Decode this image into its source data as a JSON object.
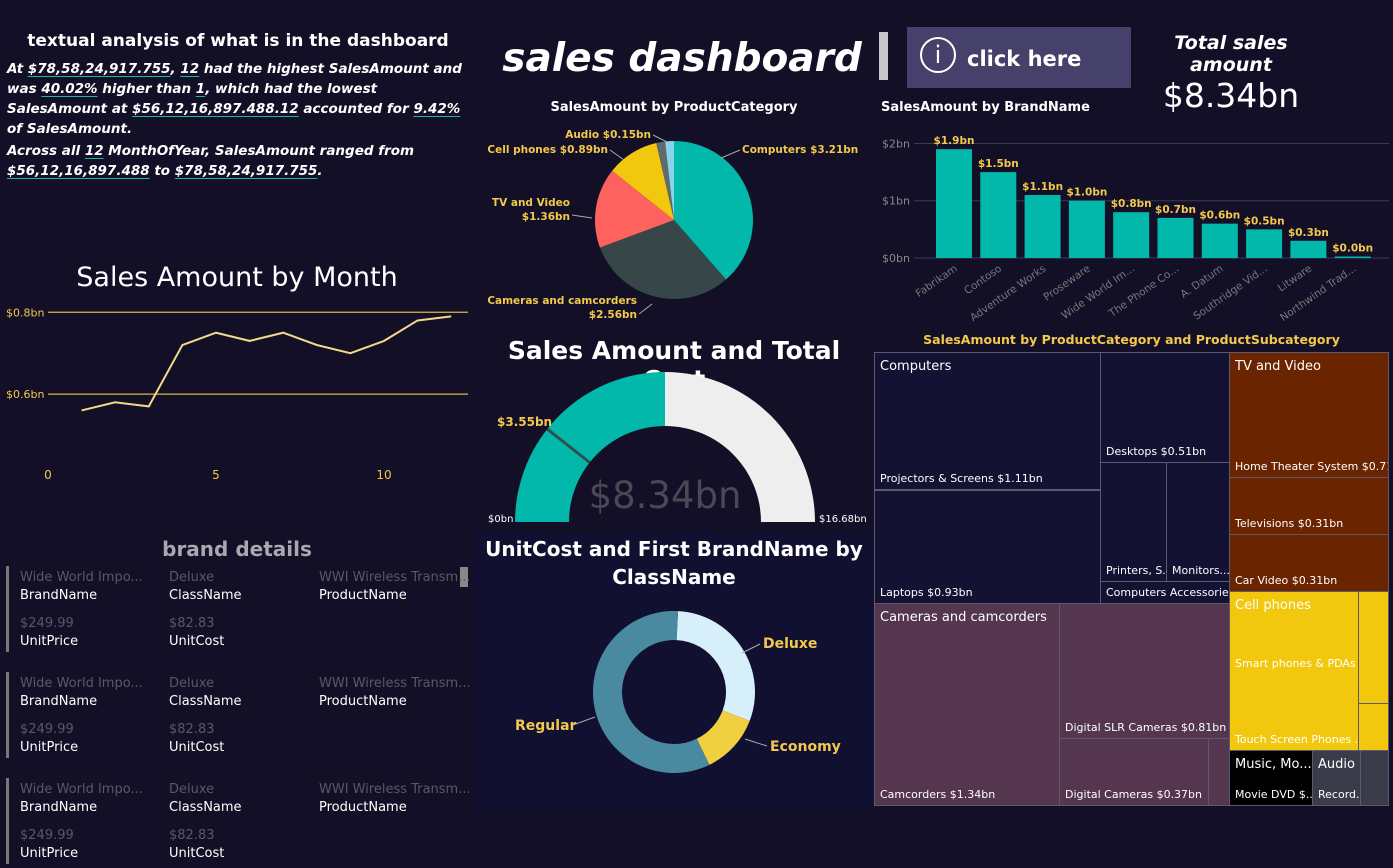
{
  "analysis": {
    "title": "textual analysis of what is in the dashboard",
    "p1": [
      "At ",
      "$78,58,24,917.755",
      ", ",
      "12",
      " had the highest SalesAmount and was ",
      "40.02%",
      " higher than ",
      "1",
      ", which had the lowest SalesAmount at ",
      "$56,12,16,897.488.12",
      " accounted for ",
      "9.42%",
      " of SalesAmount."
    ],
    "p2": [
      "Across all ",
      "12",
      " MonthOfYear, SalesAmount ranged from ",
      "$56,12,16,897.488",
      " to ",
      "$78,58,24,917.755",
      "."
    ]
  },
  "dashboard_title": "sales dashboard",
  "click_button": {
    "label": "click here",
    "icon": "info-icon"
  },
  "total": {
    "title": "Total sales amount",
    "value": "$8.34bn"
  },
  "month_chart": {
    "title": "Sales Amount by Month",
    "ref_lines": [
      "$0.8bn",
      "$0.6bn"
    ],
    "x_ticks": [
      "0",
      "5",
      "10"
    ],
    "color": "#f2c94c"
  },
  "brand_details": {
    "title": "brand details",
    "rows": [
      {
        "brand": "Wide World Impo...",
        "class": "Deluxe",
        "product": "WWI Wireless Transm...",
        "price": "$249.99",
        "cost": "$82.83"
      },
      {
        "brand": "Wide World Impo...",
        "class": "Deluxe",
        "product": "WWI Wireless Transm...",
        "price": "$249.99",
        "cost": "$82.83"
      },
      {
        "brand": "Wide World Impo...",
        "class": "Deluxe",
        "product": "WWI Wireless Transm...",
        "price": "$249.99",
        "cost": "$82.83"
      }
    ],
    "labels": {
      "brand": "BrandName",
      "class": "ClassName",
      "product": "ProductName",
      "price": "UnitPrice",
      "cost": "UnitCost"
    }
  },
  "pie_labels": {
    "title": "SalesAmount by ProductCategory",
    "audio": "Audio $0.15bn",
    "cell": "Cell phones $0.89bn",
    "tv": [
      "TV and Video",
      "$1.36bn"
    ],
    "cameras": [
      "Cameras and camcorders",
      "$2.56bn"
    ],
    "computers": "Computers $3.21bn"
  },
  "gauge": {
    "title": "Sales Amount and Total Cost",
    "center": "$8.34bn",
    "min": "$0bn",
    "max": "$16.68bn",
    "target": "$3.55bn"
  },
  "donut": {
    "title_line1": "UnitCost and First BrandName by",
    "title_line2": "ClassName",
    "deluxe": "Deluxe",
    "economy": "Economy",
    "regular": "Regular"
  },
  "brand_chart": {
    "title": "SalesAmount by BrandName",
    "y_ticks": [
      "$2bn",
      "$1bn",
      "$0bn"
    ]
  },
  "treemap": {
    "title": "SalesAmount by ProductCategory and ProductSubcategory",
    "computers": "Computers",
    "projectors": "Projectors & Screens $1.11bn",
    "laptops": "Laptops $0.93bn",
    "desktops": "Desktops $0.51bn",
    "printers": "Printers, S...",
    "monitors": "Monitors...",
    "comp_acc": "Computers Accessorie...",
    "tv": "TV and Video",
    "home_theater": "Home Theater System $0.71bn",
    "televisions": "Televisions $0.31bn",
    "car_video": "Car Video $0.31bn",
    "cameras": "Cameras and camcorders",
    "camcorders": "Camcorders $1.34bn",
    "dslr": "Digital SLR Cameras $0.81bn",
    "digital_cameras": "Digital Cameras $0.37bn",
    "cell": "Cell phones",
    "smart": "Smart phones & PDAs ...",
    "touch": "Touch Screen Phones ...",
    "music": "Music, Mo...",
    "movie": "Movie DVD $...",
    "audio": "Audio",
    "record": "Record..."
  },
  "chart_data": [
    {
      "type": "line",
      "title": "Sales Amount by Month",
      "x": [
        1,
        2,
        3,
        4,
        5,
        6,
        7,
        8,
        9,
        10,
        11,
        12
      ],
      "values": [
        0.56,
        0.58,
        0.57,
        0.72,
        0.75,
        0.73,
        0.75,
        0.72,
        0.7,
        0.73,
        0.78,
        0.79
      ],
      "xlim": [
        0,
        12.5
      ],
      "ylim": [
        0.5,
        0.83
      ],
      "ref_lines": [
        0.8,
        0.6
      ]
    },
    {
      "type": "pie",
      "title": "SalesAmount by ProductCategory",
      "categories": [
        "Computers",
        "Cameras and camcorders",
        "TV and Video",
        "Cell phones",
        "Music, Movies and Audio Books",
        "Audio"
      ],
      "values": [
        3.21,
        2.56,
        1.36,
        0.89,
        0.15,
        0.15
      ],
      "colors": [
        "#01b8aa",
        "#374649",
        "#fd625e",
        "#f2c80f",
        "#5f6b6d",
        "#8ad4eb"
      ]
    },
    {
      "type": "bar",
      "title": "SalesAmount by BrandName",
      "categories": [
        "Fabrikam",
        "Contoso",
        "Adventure Works",
        "Proseware",
        "Wide World Im...",
        "The Phone Co...",
        "A. Datum",
        "Southridge Vid...",
        "Litware",
        "Northwind Trad..."
      ],
      "values": [
        1.9,
        1.5,
        1.1,
        1.0,
        0.8,
        0.7,
        0.6,
        0.5,
        0.3,
        0.0
      ],
      "data_labels": [
        "$1.9bn",
        "$1.5bn",
        "$1.1bn",
        "$1.0bn",
        "$0.8bn",
        "$0.7bn",
        "$0.6bn",
        "$0.5bn",
        "$0.3bn",
        "$0.0bn"
      ],
      "ylim": [
        0,
        2.2
      ],
      "color": "#01b8aa"
    },
    {
      "type": "pie",
      "title": "UnitCost and First BrandName by ClassName",
      "categories": [
        "Deluxe",
        "Economy",
        "Regular"
      ],
      "values": [
        0.3,
        0.12,
        0.58
      ],
      "colors": [
        "#d6effa",
        "#f0d040",
        "#4a8aa0"
      ]
    }
  ]
}
